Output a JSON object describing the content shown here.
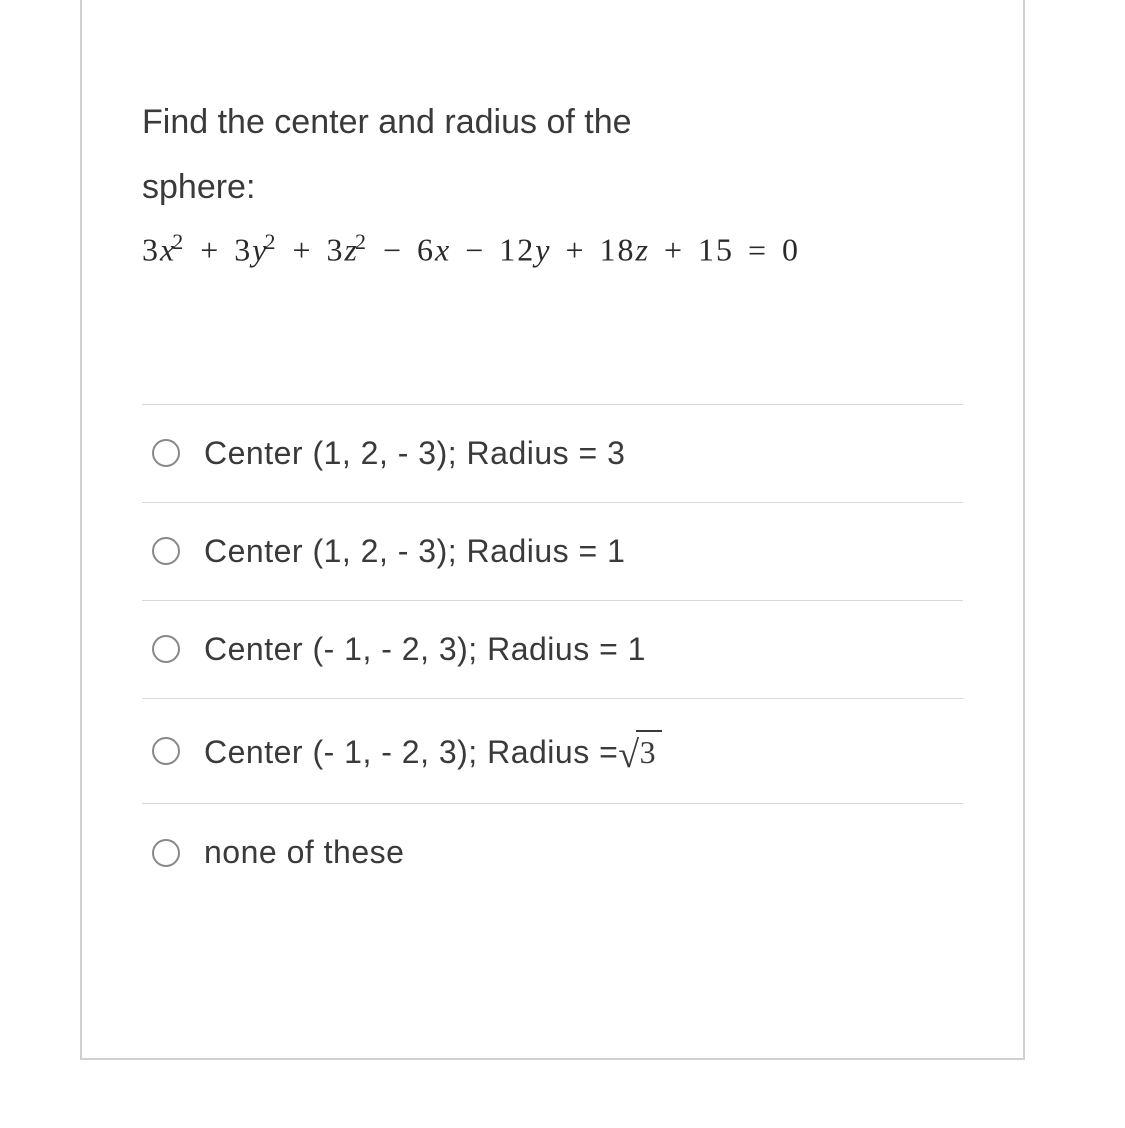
{
  "question": {
    "prompt_line1": "Find the center and radius of the",
    "prompt_line2": "sphere:",
    "equation_plain": "3x^2 + 3y^2 + 3z^2 - 6x - 12y + 18z + 15 = 0"
  },
  "options": [
    {
      "label": "Center (1, 2, - 3); Radius = 3",
      "has_sqrt": false
    },
    {
      "label": "Center (1, 2, - 3); Radius = 1",
      "has_sqrt": false
    },
    {
      "label": "Center (- 1, - 2, 3); Radius = 1",
      "has_sqrt": false
    },
    {
      "label_prefix": "Center (- 1, - 2, 3); Radius =",
      "has_sqrt": true,
      "sqrt_arg": "3"
    },
    {
      "label": "none of these",
      "has_sqrt": false
    }
  ]
}
